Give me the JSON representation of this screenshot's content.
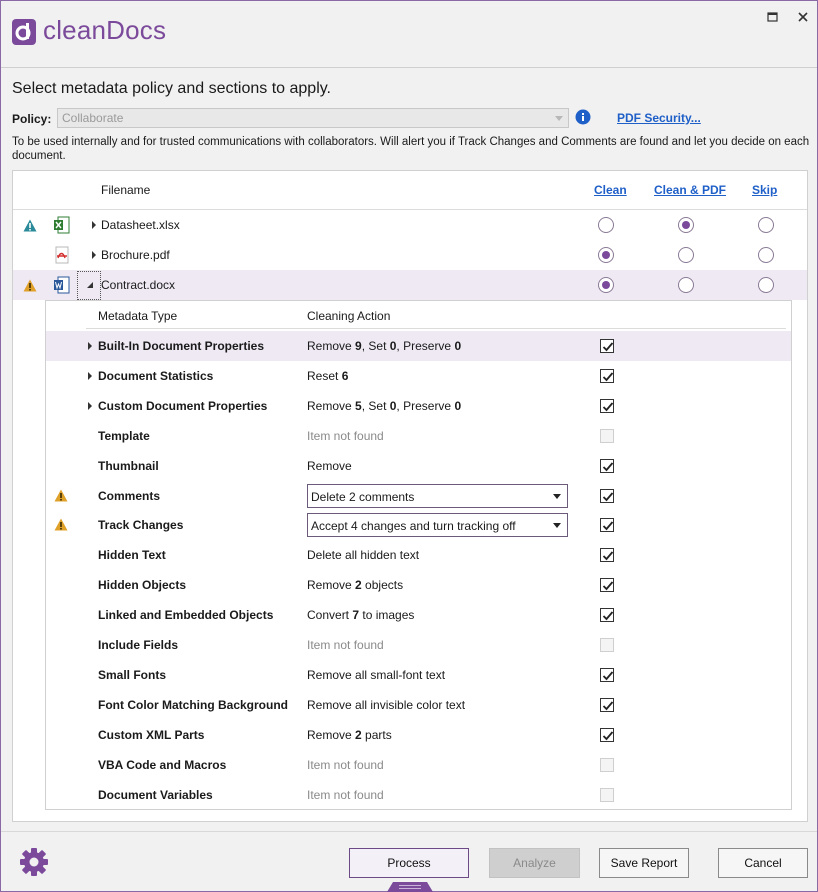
{
  "app": {
    "name": "cleanDocs"
  },
  "heading": "Select metadata policy and sections to apply.",
  "policy": {
    "label": "Policy:",
    "value": "Collaborate",
    "link": "PDF Security...",
    "description": "To be used internally and for trusted communications with collaborators. Will alert you if Track Changes and Comments are found and let you decide on each document."
  },
  "files_table": {
    "columns": {
      "filename": "Filename",
      "clean": "Clean",
      "clean_pdf": "Clean & PDF",
      "skip": "Skip"
    },
    "files": [
      {
        "name": "Datasheet.xlsx",
        "type": "excel",
        "warning": "info",
        "selected_option": "clean_pdf",
        "expanded": false
      },
      {
        "name": "Brochure.pdf",
        "type": "pdf",
        "warning": "none",
        "selected_option": "clean",
        "expanded": false
      },
      {
        "name": "Contract.docx",
        "type": "word",
        "warning": "warning",
        "selected_option": "clean",
        "expanded": true
      }
    ]
  },
  "metadata_table": {
    "columns": {
      "type": "Metadata Type",
      "action": "Cleaning Action"
    },
    "rows": [
      {
        "name": "Built-In Document Properties",
        "action_parts": [
          "Remove ",
          "9",
          ", Set ",
          "0",
          ", Preserve ",
          "0"
        ],
        "checked": true,
        "enabled": true,
        "expandable": true,
        "warning": false
      },
      {
        "name": "Document Statistics",
        "action_parts": [
          "Reset ",
          "6"
        ],
        "checked": true,
        "enabled": true,
        "expandable": true,
        "warning": false
      },
      {
        "name": "Custom Document Properties",
        "action_parts": [
          "Remove ",
          "5",
          ", Set ",
          "0",
          ", Preserve ",
          "0"
        ],
        "checked": true,
        "enabled": true,
        "expandable": true,
        "warning": false
      },
      {
        "name": "Template",
        "action_parts": [
          "Item not found"
        ],
        "checked": false,
        "enabled": false,
        "expandable": false,
        "warning": false
      },
      {
        "name": "Thumbnail",
        "action_parts": [
          "Remove"
        ],
        "checked": true,
        "enabled": true,
        "expandable": false,
        "warning": false
      },
      {
        "name": "Comments",
        "combo": "Delete 2 comments",
        "checked": true,
        "enabled": true,
        "expandable": false,
        "warning": true
      },
      {
        "name": "Track Changes",
        "combo": "Accept 4 changes and turn tracking off",
        "checked": true,
        "enabled": true,
        "expandable": false,
        "warning": true
      },
      {
        "name": "Hidden Text",
        "action_parts": [
          "Delete all hidden text"
        ],
        "checked": true,
        "enabled": true,
        "expandable": false,
        "warning": false
      },
      {
        "name": "Hidden Objects",
        "action_parts": [
          "Remove ",
          "2",
          " objects"
        ],
        "checked": true,
        "enabled": true,
        "expandable": false,
        "warning": false
      },
      {
        "name": "Linked and Embedded Objects",
        "action_parts": [
          "Convert ",
          "7",
          " to images"
        ],
        "checked": true,
        "enabled": true,
        "expandable": false,
        "warning": false
      },
      {
        "name": "Include Fields",
        "action_parts": [
          "Item not found"
        ],
        "checked": false,
        "enabled": false,
        "expandable": false,
        "warning": false
      },
      {
        "name": "Small Fonts",
        "action_parts": [
          "Remove all small-font text"
        ],
        "checked": true,
        "enabled": true,
        "expandable": false,
        "warning": false
      },
      {
        "name": "Font Color Matching Background",
        "action_parts": [
          "Remove all invisible color text"
        ],
        "checked": true,
        "enabled": true,
        "expandable": false,
        "warning": false
      },
      {
        "name": "Custom XML Parts",
        "action_parts": [
          "Remove ",
          "2",
          " parts"
        ],
        "checked": true,
        "enabled": true,
        "expandable": false,
        "warning": false
      },
      {
        "name": "VBA Code and Macros",
        "action_parts": [
          "Item not found"
        ],
        "checked": false,
        "enabled": false,
        "expandable": false,
        "warning": false
      },
      {
        "name": "Document Variables",
        "action_parts": [
          "Item not found"
        ],
        "checked": false,
        "enabled": false,
        "expandable": false,
        "warning": false
      }
    ]
  },
  "buttons": {
    "process": "Process",
    "analyze": "Analyze",
    "save_report": "Save Report",
    "cancel": "Cancel"
  },
  "colors": {
    "accent": "#7b4a9b",
    "link": "#1f5fc8",
    "selection": "#efe9f4"
  }
}
